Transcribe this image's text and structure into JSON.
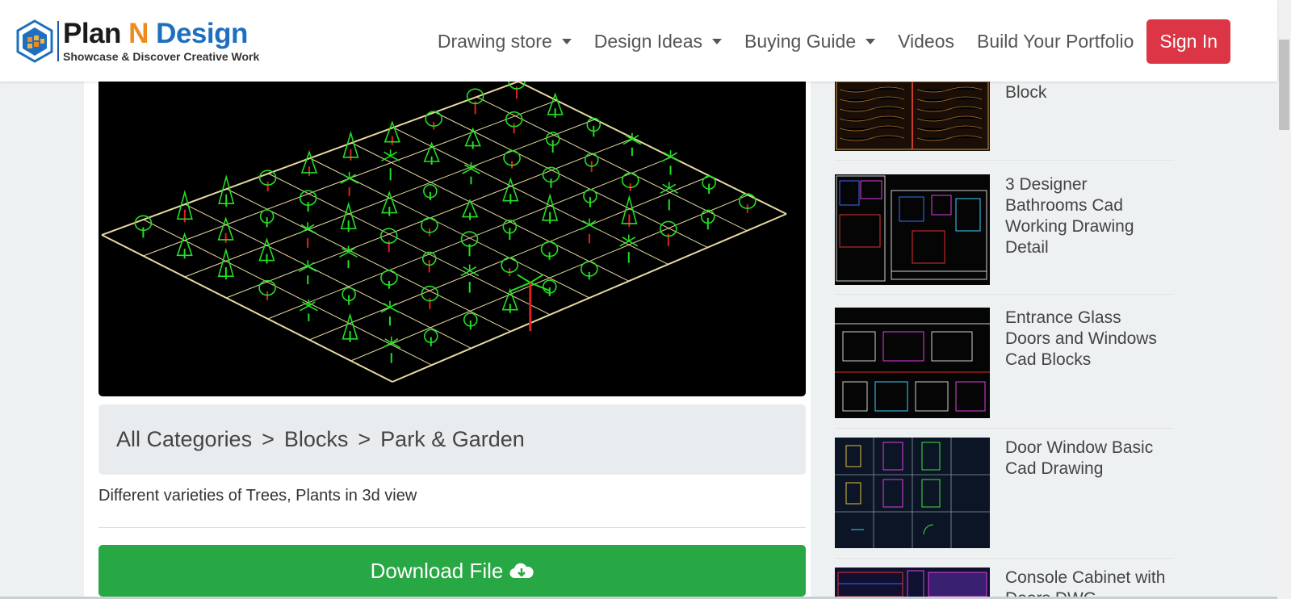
{
  "header": {
    "logo": {
      "word1": "Plan",
      "word2": "N",
      "word3": "Design",
      "tagline": "Showcase & Discover Creative Work"
    },
    "nav": [
      {
        "label": "Drawing store",
        "dropdown": true
      },
      {
        "label": "Design Ideas",
        "dropdown": true
      },
      {
        "label": "Buying Guide",
        "dropdown": true
      },
      {
        "label": "Videos",
        "dropdown": false
      },
      {
        "label": "Build Your Portfolio",
        "dropdown": false
      }
    ],
    "signin_label": "Sign In"
  },
  "main": {
    "breadcrumb": [
      "All Categories",
      "Blocks",
      "Park & Garden"
    ],
    "breadcrumb_sep": ">",
    "description": "Different varieties of Trees, Plants in 3d view",
    "download_label": "Download File"
  },
  "sidebar": {
    "items": [
      {
        "title": "Block"
      },
      {
        "title": "3 Designer Bathrooms Cad Working Drawing Detail"
      },
      {
        "title": "Entrance Glass Doors and Windows Cad Blocks"
      },
      {
        "title": "Door Window Basic Cad Drawing"
      },
      {
        "title": "Console Cabinet with Doors DWG"
      }
    ]
  },
  "colors": {
    "signin": "#dc3545",
    "download": "#28a745",
    "logo_orange": "#f08a1c",
    "logo_blue": "#1e6fbf",
    "cad_green": "#22e022",
    "cad_grid": "#e8d9a0"
  }
}
